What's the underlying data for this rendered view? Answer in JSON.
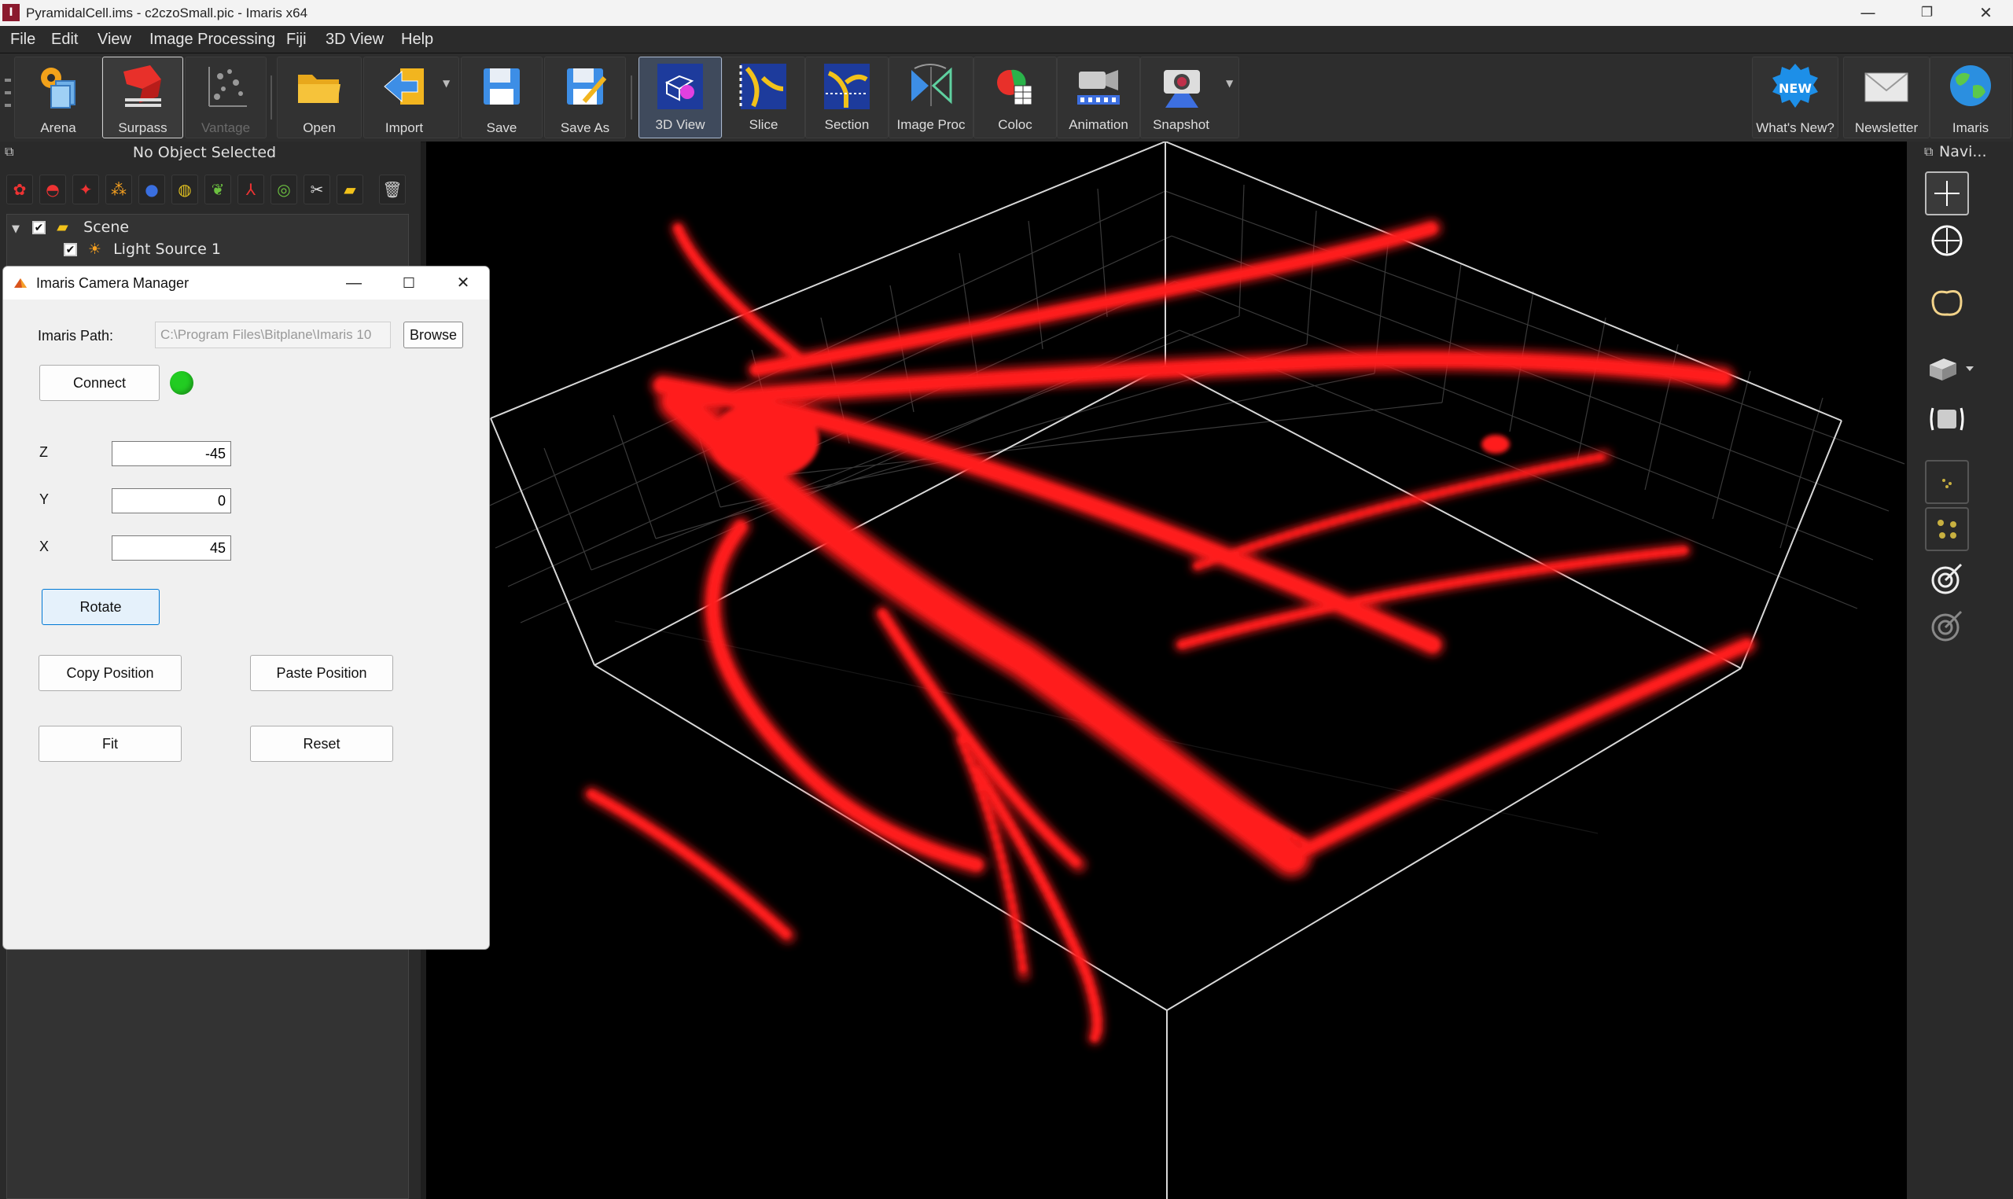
{
  "window": {
    "title": "PyramidalCell.ims - c2czoSmall.pic - Imaris x64",
    "app_icon": "I",
    "controls": {
      "minimize": "—",
      "maximize": "❐",
      "close": "✕"
    }
  },
  "menu": [
    "File",
    "Edit",
    "View",
    "Image Processing",
    "Fiji",
    "3D View",
    "Help"
  ],
  "toolbar": {
    "arena": "Arena",
    "surpass": "Surpass",
    "vantage": "Vantage",
    "open": "Open",
    "import": "Import",
    "save": "Save",
    "save_as": "Save As",
    "view3d": "3D View",
    "slice": "Slice",
    "section": "Section",
    "image_proc": "Image Proc",
    "coloc": "Coloc",
    "animation": "Animation",
    "snapshot": "Snapshot",
    "whats_new": "What's New?",
    "whats_new_badge": "NEW",
    "newsletter": "Newsletter",
    "imaris": "Imaris"
  },
  "left_panel": {
    "status": "No Object Selected",
    "tree": [
      {
        "label": "Scene",
        "checked": true
      },
      {
        "label": "Light Source 1",
        "checked": true
      }
    ]
  },
  "right_panel": {
    "title": "Navi..."
  },
  "dialog": {
    "title": "Imaris Camera Manager",
    "path_label": "Imaris Path:",
    "path_value": "C:\\Program Files\\Bitplane\\Imaris 10",
    "browse": "Browse",
    "connect": "Connect",
    "connected_color": "#22cc22",
    "z_label": "Z",
    "z_value": "-45",
    "y_label": "Y",
    "y_value": "0",
    "x_label": "X",
    "x_value": "45",
    "rotate": "Rotate",
    "copy_position": "Copy Position",
    "paste_position": "Paste Position",
    "fit": "Fit",
    "reset": "Reset"
  },
  "colors": {
    "volume": "#ff1a1a",
    "accent_blue": "#0078d4",
    "active_tool": "#3f4a5c"
  }
}
